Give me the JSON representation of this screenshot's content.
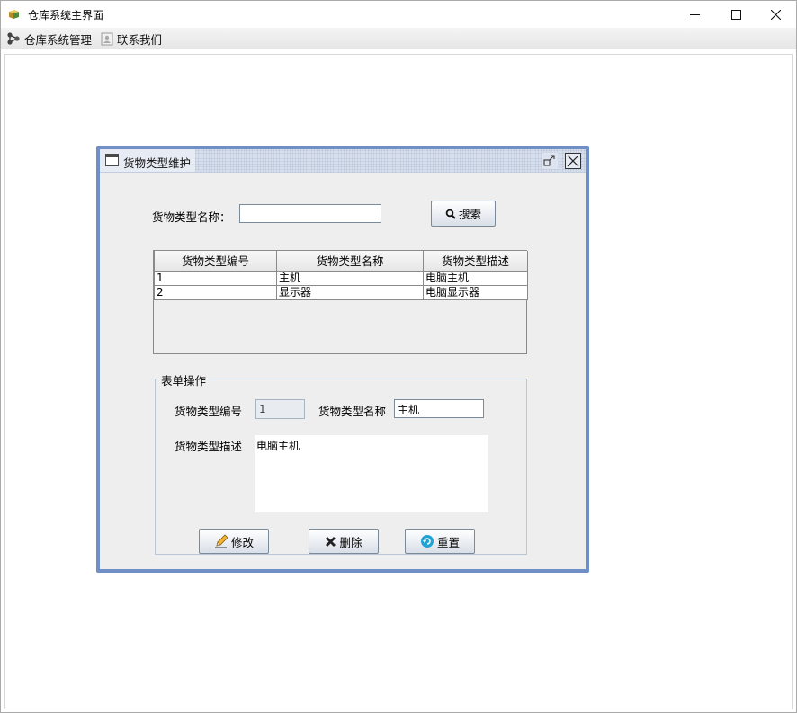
{
  "window": {
    "title": "仓库系统主界面",
    "icons": {
      "app": "package-icon"
    }
  },
  "menubar": {
    "items": [
      {
        "label": "仓库系统管理",
        "icon": "network-icon"
      },
      {
        "label": "联系我们",
        "icon": "contact-icon"
      }
    ]
  },
  "internal_frame": {
    "title": "货物类型维护",
    "search": {
      "label": "货物类型名称：",
      "value": "",
      "button_label": "搜索"
    },
    "table": {
      "columns": [
        "货物类型编号",
        "货物类型名称",
        "货物类型描述"
      ],
      "rows": [
        [
          "1",
          "主机",
          "电脑主机"
        ],
        [
          "2",
          "显示器",
          "电脑显示器"
        ]
      ]
    },
    "form": {
      "legend": "表单操作",
      "id_label": "货物类型编号",
      "id_value": "1",
      "name_label": "货物类型名称",
      "name_value": "主机",
      "desc_label": "货物类型描述",
      "desc_value": "电脑主机",
      "buttons": {
        "modify": "修改",
        "delete": "删除",
        "reset": "重置"
      }
    }
  },
  "colors": {
    "frame_border": "#6f8fc6",
    "panel_bg": "#eeeeee"
  }
}
